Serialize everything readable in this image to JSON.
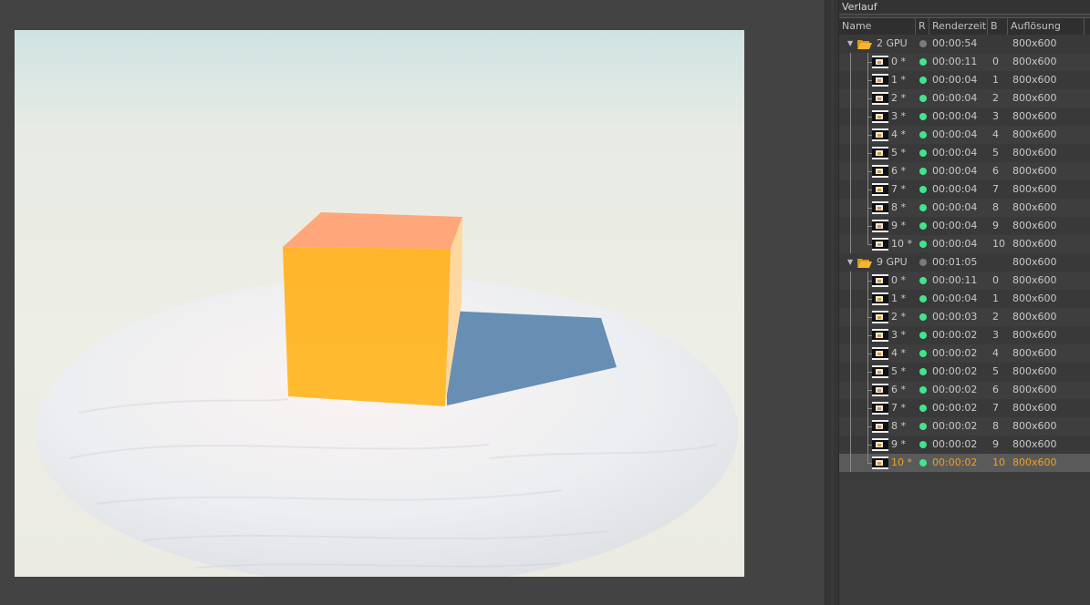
{
  "panel": {
    "title": "Verlauf",
    "columns": {
      "name": "Name",
      "r": "R",
      "renderzeit": "Renderzeit",
      "b": "B",
      "aufloesung": "Auflösung"
    }
  },
  "colors": {
    "status_done": "#3fe68a",
    "status_group": "#7a7a7a",
    "selected_text": "#f0a020",
    "folder": "#f5b532"
  },
  "groups": [
    {
      "name": "2 GPU",
      "time": "00:00:54",
      "b": "",
      "res": "800x600",
      "items": [
        {
          "name": "0 *",
          "time": "00:00:11",
          "b": "0",
          "res": "800x600"
        },
        {
          "name": "1 *",
          "time": "00:00:04",
          "b": "1",
          "res": "800x600"
        },
        {
          "name": "2 *",
          "time": "00:00:04",
          "b": "2",
          "res": "800x600"
        },
        {
          "name": "3 *",
          "time": "00:00:04",
          "b": "3",
          "res": "800x600"
        },
        {
          "name": "4 *",
          "time": "00:00:04",
          "b": "4",
          "res": "800x600"
        },
        {
          "name": "5 *",
          "time": "00:00:04",
          "b": "5",
          "res": "800x600"
        },
        {
          "name": "6 *",
          "time": "00:00:04",
          "b": "6",
          "res": "800x600"
        },
        {
          "name": "7 *",
          "time": "00:00:04",
          "b": "7",
          "res": "800x600"
        },
        {
          "name": "8 *",
          "time": "00:00:04",
          "b": "8",
          "res": "800x600"
        },
        {
          "name": "9 *",
          "time": "00:00:04",
          "b": "9",
          "res": "800x600"
        },
        {
          "name": "10 *",
          "time": "00:00:04",
          "b": "10",
          "res": "800x600"
        }
      ]
    },
    {
      "name": "9 GPU",
      "time": "00:01:05",
      "b": "",
      "res": "800x600",
      "items": [
        {
          "name": "0 *",
          "time": "00:00:11",
          "b": "0",
          "res": "800x600"
        },
        {
          "name": "1 *",
          "time": "00:00:04",
          "b": "1",
          "res": "800x600"
        },
        {
          "name": "2 *",
          "time": "00:00:03",
          "b": "2",
          "res": "800x600"
        },
        {
          "name": "3 *",
          "time": "00:00:02",
          "b": "3",
          "res": "800x600"
        },
        {
          "name": "4 *",
          "time": "00:00:02",
          "b": "4",
          "res": "800x600"
        },
        {
          "name": "5 *",
          "time": "00:00:02",
          "b": "5",
          "res": "800x600"
        },
        {
          "name": "6 *",
          "time": "00:00:02",
          "b": "6",
          "res": "800x600"
        },
        {
          "name": "7 *",
          "time": "00:00:02",
          "b": "7",
          "res": "800x600"
        },
        {
          "name": "8 *",
          "time": "00:00:02",
          "b": "8",
          "res": "800x600"
        },
        {
          "name": "9 *",
          "time": "00:00:02",
          "b": "9",
          "res": "800x600"
        },
        {
          "name": "10 *",
          "time": "00:00:02",
          "b": "10",
          "res": "800x600",
          "selected": true
        }
      ]
    }
  ]
}
